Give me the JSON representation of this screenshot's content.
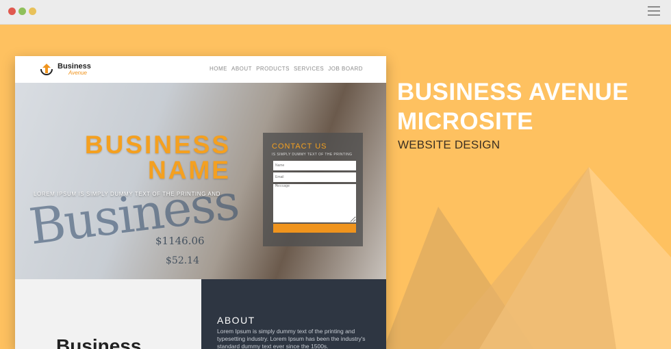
{
  "window": {
    "controls": [
      "close",
      "minimize",
      "maximize"
    ],
    "menu_icon": "hamburger-menu-icon"
  },
  "colors": {
    "background": "#fec160",
    "accent": "#f0941d",
    "dark_panel": "#2e3642"
  },
  "mockup": {
    "logo": {
      "line1": "Business",
      "line2": "Avenue"
    },
    "nav": [
      "HOME",
      "ABOUT",
      "PRODUCTS",
      "SERVICES",
      "JOB BOARD"
    ],
    "hero": {
      "title_line1": "BUSINESS",
      "title_line2": "NAME",
      "subtitle": "LOREM IPSUM IS SIMPLY DUMMY TEXT OF THE PRINTING AND",
      "newspaper_word": "Business",
      "price1": "$1146.06",
      "price2": "$52.14"
    },
    "contact": {
      "title": "CONTACT US",
      "subtitle": "IS SIMPLY DUMMY TEXT OF THE PRINTING",
      "name_placeholder": "Name",
      "email_placeholder": "Email",
      "message_placeholder": "Message"
    },
    "about": {
      "title": "ABOUT",
      "text": "Lorem Ipsum is simply dummy text of the printing and typesetting industry. Lorem Ipsum has been the industry's standard dummy text ever since the 1500s."
    },
    "lower_logo": "Business"
  },
  "headline": {
    "line1": "BUSINESS AVENUE",
    "line2": "MICROSITE",
    "subtitle": "WEBSITE DESIGN"
  }
}
